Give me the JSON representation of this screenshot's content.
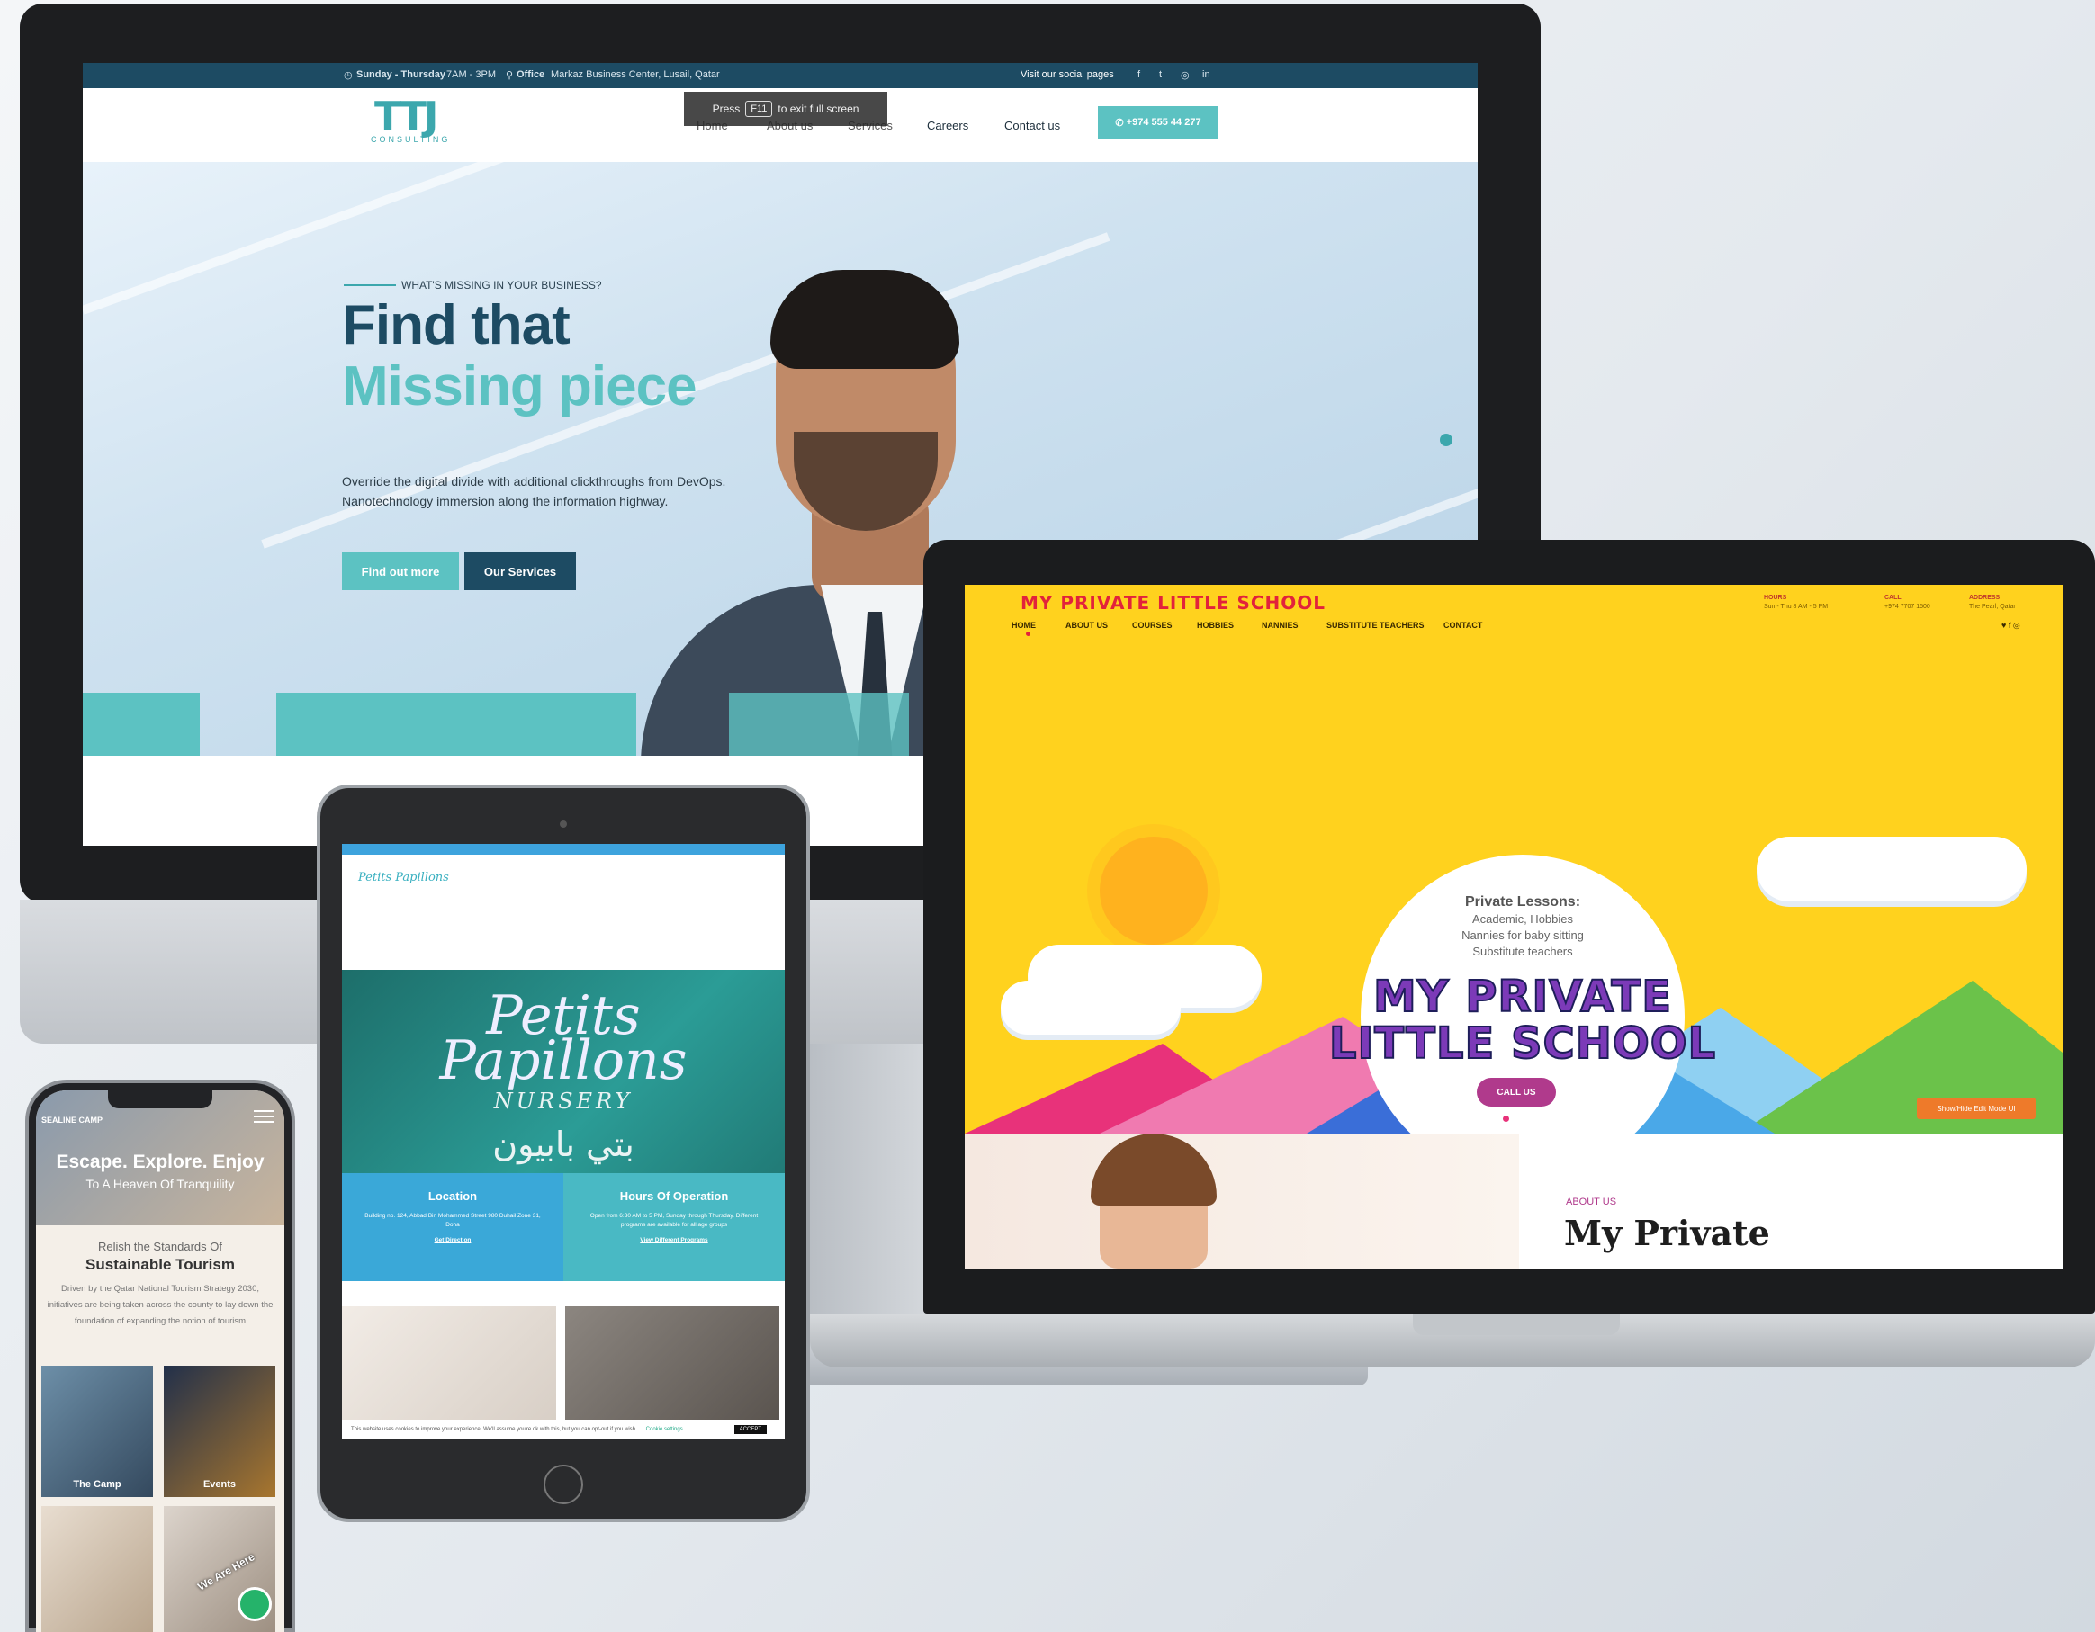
{
  "monitor": {
    "topbar": {
      "hours": "Sunday - Thursday",
      "hours_time": "7AM - 3PM",
      "office_label": "Office",
      "office_address": "Markaz Business Center, Lusail, Qatar",
      "social_label": "Visit our social pages",
      "social_icons": [
        "f",
        "t",
        "◎",
        "in"
      ]
    },
    "logo": {
      "mark": "TTJ",
      "word": "CONSULTING"
    },
    "nav": {
      "items": [
        "Home",
        "About us",
        "Services",
        "Careers",
        "Contact us"
      ],
      "phone_button": "+974 555 44 277"
    },
    "fullscreen_notice": {
      "press": "Press",
      "key": "F11",
      "rest": "to exit full screen"
    },
    "hero": {
      "eyebrow": "WHAT'S MISSING IN YOUR BUSINESS?",
      "title_line1": "Find that",
      "title_line2": "Missing piece",
      "copy_line1": "Override the digital divide with additional clickthroughs from DevOps.",
      "copy_line2": "Nanotechnology immersion along the information highway.",
      "btn_primary": "Find out more",
      "btn_secondary": "Our Services"
    }
  },
  "laptop": {
    "logo": "MY PRIVATE LITTLE SCHOOL",
    "nav": [
      "HOME",
      "ABOUT US",
      "COURSES",
      "HOBBIES",
      "NANNIES",
      "SUBSTITUTE TEACHERS",
      "CONTACT"
    ],
    "info": [
      {
        "label": "HOURS",
        "value": "Sun - Thu 8 AM - 5 PM"
      },
      {
        "label": "CALL",
        "value": "+974 7707 1500"
      },
      {
        "label": "ADDRESS",
        "value": "The Pearl, Qatar"
      }
    ],
    "social": "♥ f ◎",
    "hero": {
      "lessons_title": "Private Lessons:",
      "lessons_1": "Academic, Hobbies",
      "lessons_2": "Nannies for baby sitting",
      "lessons_3": "Substitute teachers",
      "big_line1": "MY PRIVATE",
      "big_line2": "LITTLE SCHOOL",
      "call_button": "CALL US",
      "showhide": "Show/Hide Edit Mode UI"
    },
    "about": {
      "eyebrow": "ABOUT US",
      "title": "My Private"
    }
  },
  "tablet": {
    "logo": "Petits Papillons",
    "hero": {
      "line1": "Petits",
      "line2": "Papillons",
      "nursery": "NURSERY",
      "arabic": "بتي بابيون"
    },
    "cards": [
      {
        "title": "Location",
        "text": "Building no. 124, Abbad Bin Mohammed Street 980 Duhail Zone 31, Doha",
        "link": "Get Direction",
        "color": "#3aa8d8"
      },
      {
        "title": "Hours Of Operation",
        "text": "Open from 6:30 AM to 5 PM, Sunday through Thursday. Different programs are available for all age groups",
        "link": "View Different Programs",
        "color": "#49b9c4"
      }
    ],
    "cookie": {
      "text": "This website uses cookies to improve your experience. We'll assume you're ok with this, but you can opt-out if you wish.",
      "settings": "Cookie settings",
      "accept": "ACCEPT"
    }
  },
  "phone": {
    "logo": "SEALINE CAMP",
    "hero_title": "Escape. Explore. Enjoy",
    "hero_sub": "To A Heaven Of Tranquility",
    "relish": "Relish the Standards Of",
    "sustainable": "Sustainable Tourism",
    "body": "Driven by the Qatar National Tourism Strategy 2030, initiatives are being taken across the county to lay down the foundation of expanding the notion of tourism",
    "tiles": [
      "The Camp",
      "Events"
    ],
    "chat_label": "We Are Here"
  },
  "colors": {
    "ttj_navy": "#1d4b63",
    "ttj_teal": "#5cc2c2",
    "school_yellow": "#ffd21e",
    "school_purple": "#b03a8c",
    "nursery_teal": "#2b9c96"
  }
}
